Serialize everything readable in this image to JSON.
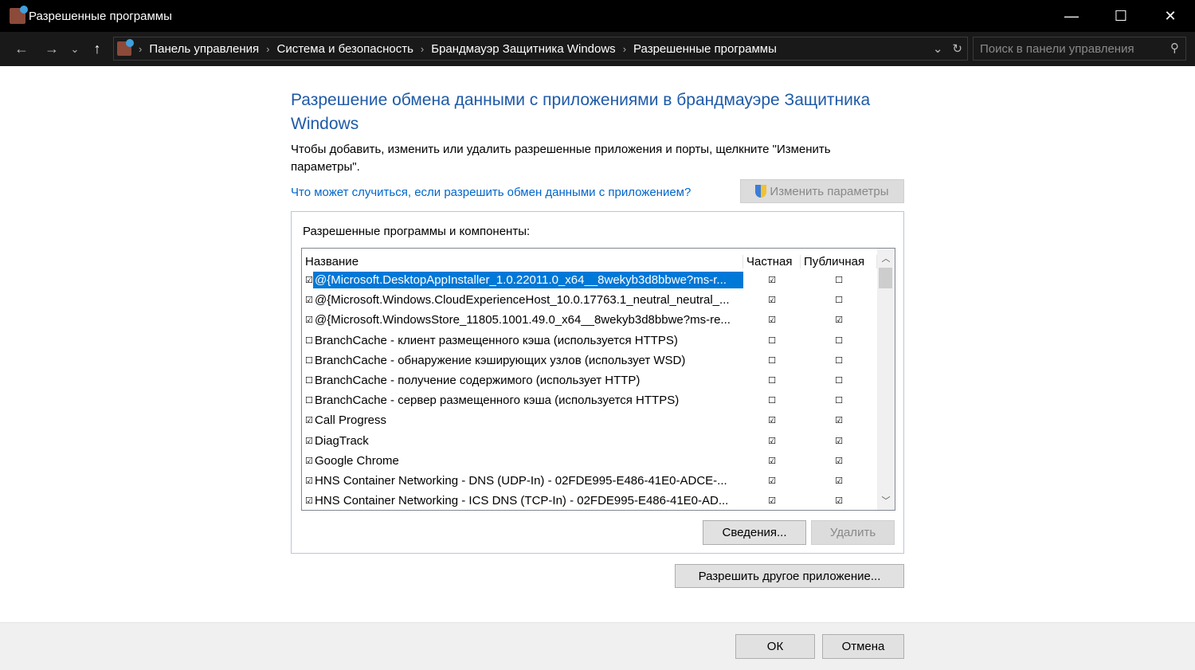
{
  "window": {
    "title": "Разрешенные программы",
    "minimize": "—",
    "maximize": "☐",
    "close": "✕"
  },
  "address": {
    "back": "←",
    "forward": "→",
    "recent": "⌄",
    "up": "↑",
    "crumbs": [
      "Панель управления",
      "Система и безопасность",
      "Брандмауэр Защитника Windows",
      "Разрешенные программы"
    ],
    "dropdown": "⌄",
    "refresh": "↻",
    "search_placeholder": "Поиск в панели управления",
    "search_icon": "⚲"
  },
  "main": {
    "heading": "Разрешение обмена данными с приложениями в брандмауэре Защитника Windows",
    "description": "Чтобы добавить, изменить или удалить разрешенные приложения и порты, щелкните \"Изменить параметры\".",
    "help_link": "Что может случиться, если разрешить обмен данными с приложением?",
    "change_settings": "Изменить параметры",
    "group_label": "Разрешенные программы и компоненты:",
    "columns": {
      "name": "Название",
      "private": "Частная",
      "public": "Публичная"
    },
    "rows": [
      {
        "enabled": "☑",
        "name": "@{Microsoft.DesktopAppInstaller_1.0.22011.0_x64__8wekyb3d8bbwe?ms-r...",
        "private": "☑",
        "public": "☐",
        "selected": true
      },
      {
        "enabled": "☑",
        "name": "@{Microsoft.Windows.CloudExperienceHost_10.0.17763.1_neutral_neutral_...",
        "private": "☑",
        "public": "☐"
      },
      {
        "enabled": "☑",
        "name": "@{Microsoft.WindowsStore_11805.1001.49.0_x64__8wekyb3d8bbwe?ms-re...",
        "private": "☑",
        "public": "☑"
      },
      {
        "enabled": "☐",
        "name": "BranchCache - клиент размещенного кэша (используется HTTPS)",
        "private": "☐",
        "public": "☐"
      },
      {
        "enabled": "☐",
        "name": "BranchCache - обнаружение кэширующих узлов (использует WSD)",
        "private": "☐",
        "public": "☐"
      },
      {
        "enabled": "☐",
        "name": "BranchCache - получение содержимого (использует HTTP)",
        "private": "☐",
        "public": "☐"
      },
      {
        "enabled": "☐",
        "name": "BranchCache - сервер размещенного кэша (используется HTTPS)",
        "private": "☐",
        "public": "☐"
      },
      {
        "enabled": "☑",
        "name": "Call Progress",
        "private": "☑",
        "public": "☑"
      },
      {
        "enabled": "☑",
        "name": "DiagTrack",
        "private": "☑",
        "public": "☑"
      },
      {
        "enabled": "☑",
        "name": "Google Chrome",
        "private": "☑",
        "public": "☑"
      },
      {
        "enabled": "☑",
        "name": "HNS Container Networking - DNS (UDP-In) - 02FDE995-E486-41E0-ADCE-...",
        "private": "☑",
        "public": "☑"
      },
      {
        "enabled": "☑",
        "name": "HNS Container Networking - ICS DNS (TCP-In) - 02FDE995-E486-41E0-AD...",
        "private": "☑",
        "public": "☑"
      }
    ],
    "details": "Сведения...",
    "delete": "Удалить",
    "allow_other": "Разрешить другое приложение..."
  },
  "footer": {
    "ok": "ОК",
    "cancel": "Отмена"
  }
}
